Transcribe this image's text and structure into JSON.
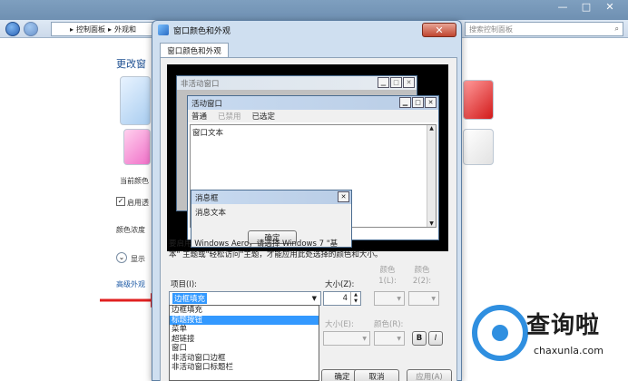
{
  "background": {
    "address": {
      "crumb1": "控制面板",
      "crumb2": "外观和"
    },
    "search_placeholder": "搜索控制面板",
    "window_controls": [
      "—",
      "□",
      "✕"
    ],
    "title_partial": "更改窗",
    "current_color_label": "当前颜色",
    "enable_transparency_label": "启用透",
    "color_intensity_label": "颜色浓度",
    "show_mixer_label": "显示",
    "advanced_link": "高级外观"
  },
  "dialog": {
    "title": "窗口颜色和外观",
    "close_glyph": "✕",
    "tab_label": "窗口颜色和外观",
    "preview": {
      "inactive_title": "非活动窗口",
      "active_title": "活动窗口",
      "menu": [
        "普通",
        "已禁用",
        "已选定"
      ],
      "window_text": "窗口文本",
      "msgbox_title": "消息框",
      "msgbox_text": "消息文本",
      "ok_label": "确定"
    },
    "description": "要启用 Windows Aero，请选择 Windows 7 \"基本\" 主题或\"轻松访问\"主题，才能应用此处选择的颜色和大小。",
    "description_line1": "要启用 Windows Aero，请选择 Windows 7 \"基",
    "description_line2": "本\" 主题或\"轻松访问\"主题，才能应用此处选择的颜色和大小。",
    "item_label": "项目(I):",
    "item_value": "边框填充",
    "size_label": "大小(Z):",
    "size_value": "4",
    "color1_label_a": "颜色",
    "color1_label_b": "1(L):",
    "color2_label_a": "颜色",
    "color2_label_b": "2(2):",
    "font_size_label": "大小(E):",
    "font_color_label": "颜色(R):",
    "bold_label": "B",
    "italic_label": "I",
    "dropdown_items": [
      "边框填充",
      "标题按钮",
      "菜单",
      "超链接",
      "窗口",
      "非活动窗口边框",
      "非活动窗口标题栏"
    ],
    "dropdown_selected": 1,
    "ok_button": "确定",
    "cancel_button": "取消",
    "apply_button": "应用(A)"
  },
  "watermark": {
    "brand": "查询啦",
    "url": "chaxunla.com"
  },
  "colors": {
    "selection": "#3399ff",
    "arrow": "#e02020",
    "accent": "#1d5aa6"
  }
}
